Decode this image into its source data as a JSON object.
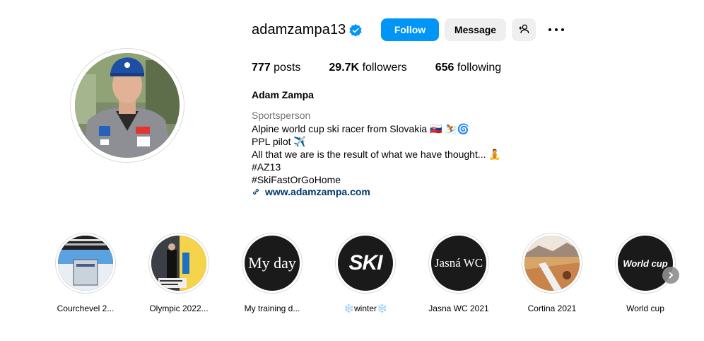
{
  "profile": {
    "username": "adamzampa13",
    "verified_icon": "verified-badge-icon",
    "follow_label": "Follow",
    "message_label": "Message",
    "add_user_icon": "add-user-icon",
    "more_icon": "more-options-icon"
  },
  "stats": {
    "posts_count": "777",
    "posts_label": "posts",
    "followers_count": "29.7K",
    "followers_label": "followers",
    "following_count": "656",
    "following_label": "following"
  },
  "bio": {
    "full_name": "Adam Zampa",
    "category": "Sportsperson",
    "lines": [
      "Alpine world cup ski racer from Slovakia 🇸🇰 ⛷️🌀",
      "PPL pilot ✈️",
      "All that we are is the result of what we have thought... 🧘",
      "#AZ13",
      "#SkiFastOrGoHome"
    ],
    "website": "www.adamzampa.com",
    "link_icon": "link-icon"
  },
  "highlights": [
    {
      "label": "Courchevel 2...",
      "cover": "photo"
    },
    {
      "label": "Olympic 2022...",
      "cover": "photo"
    },
    {
      "label": "My training d...",
      "cover_text": "My day"
    },
    {
      "label": "❄️winter❄️",
      "cover_text": "SKI"
    },
    {
      "label": "Jasna WC 2021",
      "cover_text": "Jasná WC"
    },
    {
      "label": "Cortina 2021",
      "cover": "photo"
    },
    {
      "label": "World cup",
      "cover_text": "World cup"
    }
  ],
  "colors": {
    "follow_blue": "#0095f6",
    "verified_blue": "#0095f6",
    "link_color": "#00376b",
    "secondary_text": "#737373"
  },
  "next_icon": "chevron-right-icon"
}
